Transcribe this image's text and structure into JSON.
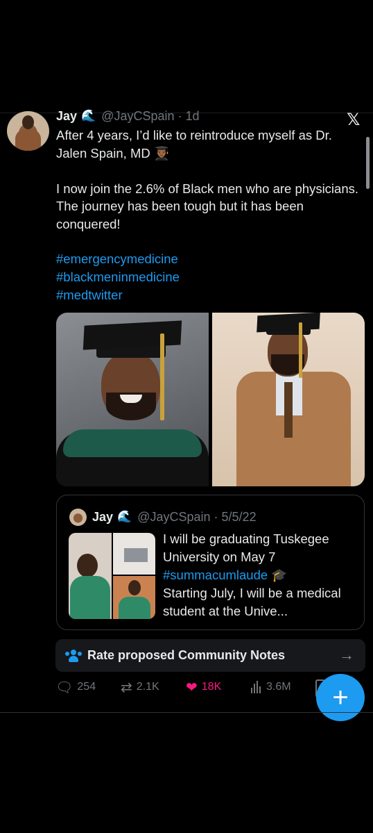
{
  "tweet": {
    "author_name": "Jay",
    "author_badge": "wave-icon",
    "author_handle_time": "@JayCSpain · 1d",
    "text": "After 4 years, I’d like to reintroduce myself as Dr. Jalen Spain, MD 👨🏾‍🎓\n\nI now join the 2.6% of Black men who are physicians. The journey has been tough but it has been conquered!",
    "hashtags": [
      "#emergencymedicine",
      "#blackmeninmedicine",
      "#medtwitter"
    ]
  },
  "quote": {
    "author_name": "Jay",
    "author_handle_date": "@JayCSpain · 5/5/22",
    "text_before": "I will be graduating Tuskegee University on May 7",
    "hashtag": "#summacumlaude",
    "text_after": "Starting July, I will be a medical student at the Unive..."
  },
  "community_notes": {
    "label": "Rate proposed Community Notes"
  },
  "actions": {
    "replies": "254",
    "reposts": "2.1K",
    "likes": "18K",
    "views": "3.6M"
  },
  "fab": {
    "label": "+"
  },
  "colors": {
    "background": "#000000",
    "accent": "#1d9bf0",
    "like": "#f91880",
    "muted": "#71767b"
  }
}
